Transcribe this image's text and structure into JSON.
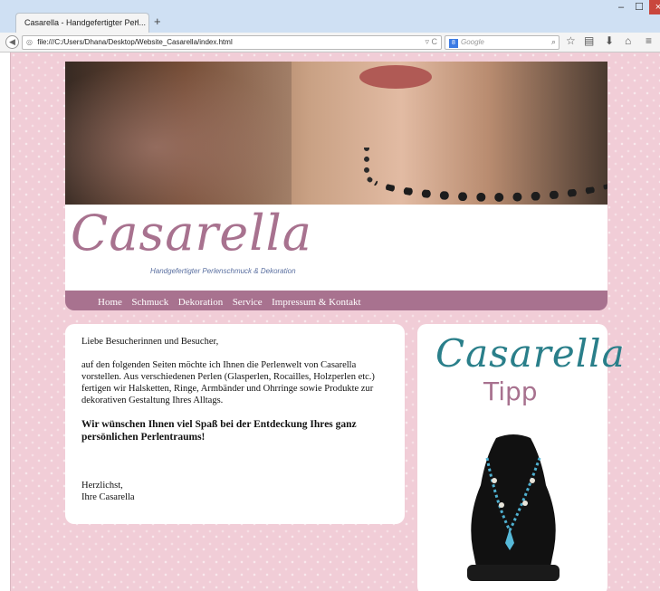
{
  "browser": {
    "tab_title": "Casarella - Handgefertigter Perl...",
    "tab_close": "×",
    "new_tab": "+",
    "window_min": "–",
    "window_max": "☐",
    "window_close": "×",
    "url": "file:///C:/Users/Dhana/Desktop/Website_Casarella/index.html",
    "search_placeholder": "Google",
    "search_engine_icon": "google-icon"
  },
  "site": {
    "logo": "Casarella",
    "tagline": "Handgefertigter Perlenschmuck & Dekoration",
    "menu": [
      "Home",
      "Schmuck",
      "Dekoration",
      "Service",
      "Impressum & Kontakt"
    ],
    "brand_color": "#a8728f",
    "background_color": "#f1cdd7"
  },
  "content": {
    "greeting": "Liebe Besucherinnen und Besucher,",
    "intro": "auf den folgenden Seiten möchte ich Ihnen die Perlenwelt von Casarella vorstellen. Aus verschiedenen Perlen (Glasperlen, Rocailles, Holzperlen etc.) fertigen wir Halsketten, Ringe, Armbänder und Ohrringe sowie Produkte zur dekorativen Gestaltung Ihres Alltags.",
    "wish": "Wir wünschen Ihnen viel Spaß bei der Entdeckung Ihres ganz persönlichen Perlentraums!",
    "closing": "Herzlichst,",
    "signature": "Ihre Casarella"
  },
  "tipp": {
    "logo": "Casarella",
    "label": "Tipp",
    "accent_color": "#2a7f8a"
  }
}
